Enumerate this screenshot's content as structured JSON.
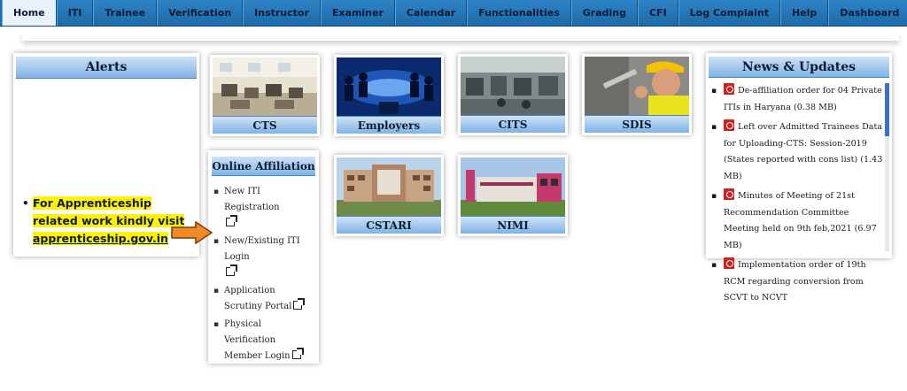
{
  "nav": {
    "items": [
      "Home",
      "ITI",
      "Trainee",
      "Verification",
      "Instructor",
      "Examiner",
      "Calendar",
      "Functionalities",
      "Grading",
      "CFI",
      "Log Complaint",
      "Help",
      "Dashboard"
    ]
  },
  "alerts": {
    "title": "Alerts",
    "line1": "For Apprenticeship related work kindly visit",
    "link": "apprenticeship.gov.in"
  },
  "tiles": {
    "cts": "CTS",
    "employers": "Employers",
    "cits": "CITS",
    "sdis": "SDIS",
    "cstari": "CSTARI",
    "nimi": "NIMI"
  },
  "affiliation": {
    "title": "Online Affiliation",
    "items": [
      "New ITI Registration",
      "New/Existing ITI Login",
      "Application Scrutiny Portal",
      "Physical Verification Member Login"
    ]
  },
  "news": {
    "title": "News & Updates",
    "items": [
      "De-affiliation order for 04 Private ITIs in Haryana (0.38 MB)",
      "Left over Admitted Trainees Data for Uploading-CTS: Session-2019 (States reported with cons list) (1.43 MB)",
      "Minutes of Meeting of 21st Recommendation Committee Meeting held on 9th feb,2021 (6.97 MB)",
      "Implementation order of 19th RCM regarding conversion from SCVT to NCVT"
    ]
  },
  "colors": {
    "nav_blue": "#1b6fb0",
    "header_blue": "#7fb3e6",
    "alert_highlight": "#fff200",
    "pdf_red": "#d0211d",
    "arrow_orange": "#f08a24"
  }
}
